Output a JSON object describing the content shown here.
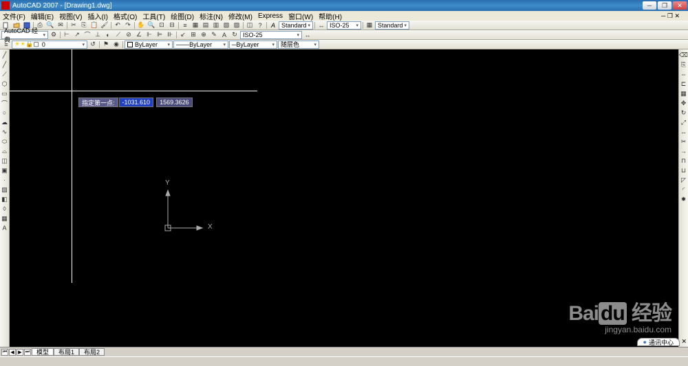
{
  "title": "AutoCAD 2007 - [Drawing1.dwg]",
  "menu": {
    "file": "文件(F)",
    "edit": "编辑(E)",
    "view": "视图(V)",
    "insert": "插入(I)",
    "format": "格式(O)",
    "tools": "工具(T)",
    "draw": "绘图(D)",
    "dim": "标注(N)",
    "modify": "修改(M)",
    "express": "Express",
    "window": "窗口(W)",
    "help": "帮助(H)"
  },
  "workspace_dd": "AutoCAD 经典",
  "style1": "Standard",
  "dim_style": "ISO-25",
  "style2": "Standard",
  "dim_style2": "ISO-25",
  "layer_combo": "0",
  "props": {
    "bylayer1": "ByLayer",
    "bylayer2": "ByLayer",
    "bylayer3": "ByLayer",
    "color": "随层色"
  },
  "dynamic_input": {
    "label": "指定第一点:",
    "x": "-1031.610",
    "y": "1569.3626"
  },
  "ucs": {
    "x": "X",
    "y": "Y"
  },
  "tabs": {
    "model": "模型",
    "layout1": "布局1",
    "layout2": "布局2"
  },
  "comm_center": "通讯中心",
  "watermark": {
    "brand_a": "Bai",
    "brand_b": "du",
    "brand_c": "经验",
    "url": "jingyan.baidu.com"
  }
}
